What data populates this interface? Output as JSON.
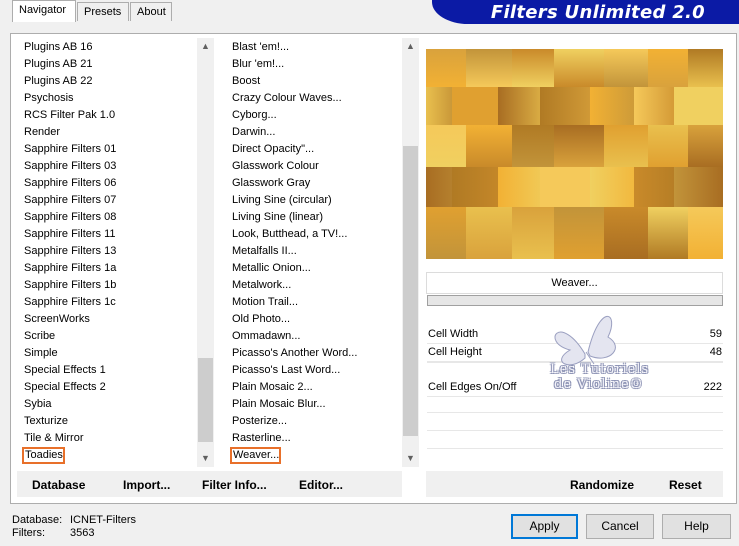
{
  "tabs": [
    {
      "label": "Navigator",
      "active": true
    },
    {
      "label": "Presets",
      "active": false
    },
    {
      "label": "About",
      "active": false
    }
  ],
  "banner": {
    "title": "Filters Unlimited 2.0"
  },
  "categories": {
    "items": [
      "Plugins AB 16",
      "Plugins AB 21",
      "Plugins AB 22",
      "Psychosis",
      "RCS Filter Pak 1.0",
      "Render",
      "Sapphire Filters 01",
      "Sapphire Filters 03",
      "Sapphire Filters 06",
      "Sapphire Filters 07",
      "Sapphire Filters 08",
      "Sapphire Filters 11",
      "Sapphire Filters 13",
      "Sapphire Filters 1a",
      "Sapphire Filters 1b",
      "Sapphire Filters 1c",
      "ScreenWorks",
      "Scribe",
      "Simple",
      "Special Effects 1",
      "Special Effects 2",
      "Sybia",
      "Texturize",
      "Tile & Mirror",
      "Toadies"
    ],
    "selected": "Toadies"
  },
  "filters": {
    "items": [
      "Blast 'em!...",
      "Blur 'em!...",
      "Boost",
      "Crazy Colour Waves...",
      "Cyborg...",
      "Darwin...",
      "Direct Opacity\"...",
      "Glasswork Colour",
      "Glasswork Gray",
      "Living Sine (circular)",
      "Living Sine (linear)",
      "Look, Butthead, a TV!...",
      "Metalfalls II...",
      "Metallic Onion...",
      "Metalwork...",
      "Motion Trail...",
      "Old Photo...",
      "Ommadawn...",
      "Picasso's Another Word...",
      "Picasso's Last Word...",
      "Plain Mosaic 2...",
      "Plain Mosaic Blur...",
      "Posterize...",
      "Rasterline...",
      "Weaver..."
    ],
    "selected": "Weaver..."
  },
  "filter_title": "Weaver...",
  "params": [
    {
      "label": "Cell Width",
      "value": "59"
    },
    {
      "label": "Cell Height",
      "value": "48"
    },
    {
      "label": "Cell Edges On/Off",
      "value": "222"
    }
  ],
  "watermark": {
    "line1": "Les Tutoriels",
    "line2": "de Violine©"
  },
  "bottom_links": {
    "database": "Database",
    "import": "Import...",
    "filter_info": "Filter Info...",
    "editor": "Editor...",
    "randomize": "Randomize",
    "reset": "Reset"
  },
  "status": {
    "database_label": "Database:",
    "database_value": "ICNET-Filters",
    "filters_label": "Filters:",
    "filters_value": "3563"
  },
  "buttons": {
    "apply": "Apply",
    "cancel": "Cancel",
    "help": "Help"
  },
  "colors": {
    "banner": "#0b1aa5",
    "highlight": "#e8702a",
    "default_button_border": "#0078d7"
  }
}
